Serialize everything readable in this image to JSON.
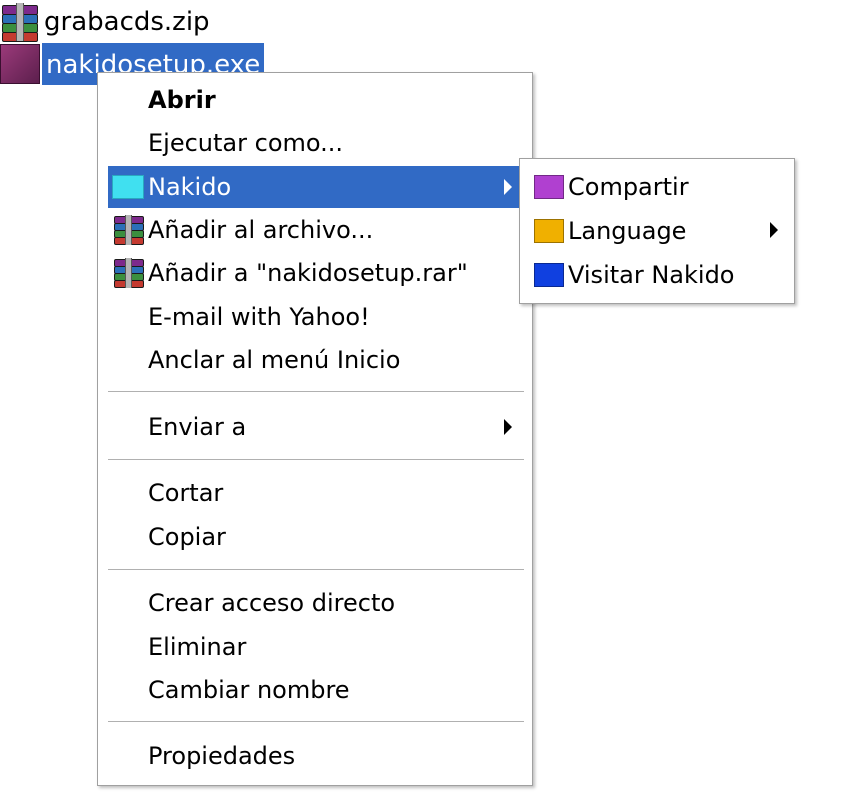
{
  "desktop": {
    "files": [
      {
        "label": "grabacds.zip",
        "icon": "winrar-archive-icon"
      },
      {
        "label": "nakidosetup.exe",
        "icon": "nakido-setup-icon",
        "selected": true
      }
    ]
  },
  "context_menu": {
    "items": [
      {
        "label": "Abrir",
        "bold": true
      },
      {
        "label": "Ejecutar como..."
      },
      {
        "label": "Nakido",
        "icon": "nakido-icon",
        "has_submenu": true,
        "highlighted": true
      },
      {
        "label": "Añadir al archivo...",
        "icon": "winrar-icon"
      },
      {
        "label": "Añadir a \"nakidosetup.rar\"",
        "icon": "winrar-icon"
      },
      {
        "label": "E-mail with Yahoo!"
      },
      {
        "label": "Anclar al menú Inicio"
      },
      {
        "label": "Enviar a",
        "has_submenu": true
      },
      {
        "label": "Cortar"
      },
      {
        "label": "Copiar"
      },
      {
        "label": "Crear acceso directo"
      },
      {
        "label": "Eliminar"
      },
      {
        "label": "Cambiar nombre"
      },
      {
        "label": "Propiedades"
      }
    ]
  },
  "submenu": {
    "items": [
      {
        "label": "Compartir",
        "color": "#b040d0"
      },
      {
        "label": "Language",
        "color": "#f0b000",
        "has_submenu": true
      },
      {
        "label": "Visitar Nakido",
        "color": "#1040e0"
      }
    ]
  },
  "colors": {
    "highlight": "#316ac5",
    "menu_background": "#ffffff",
    "menu_border": "#a0a0a0"
  }
}
